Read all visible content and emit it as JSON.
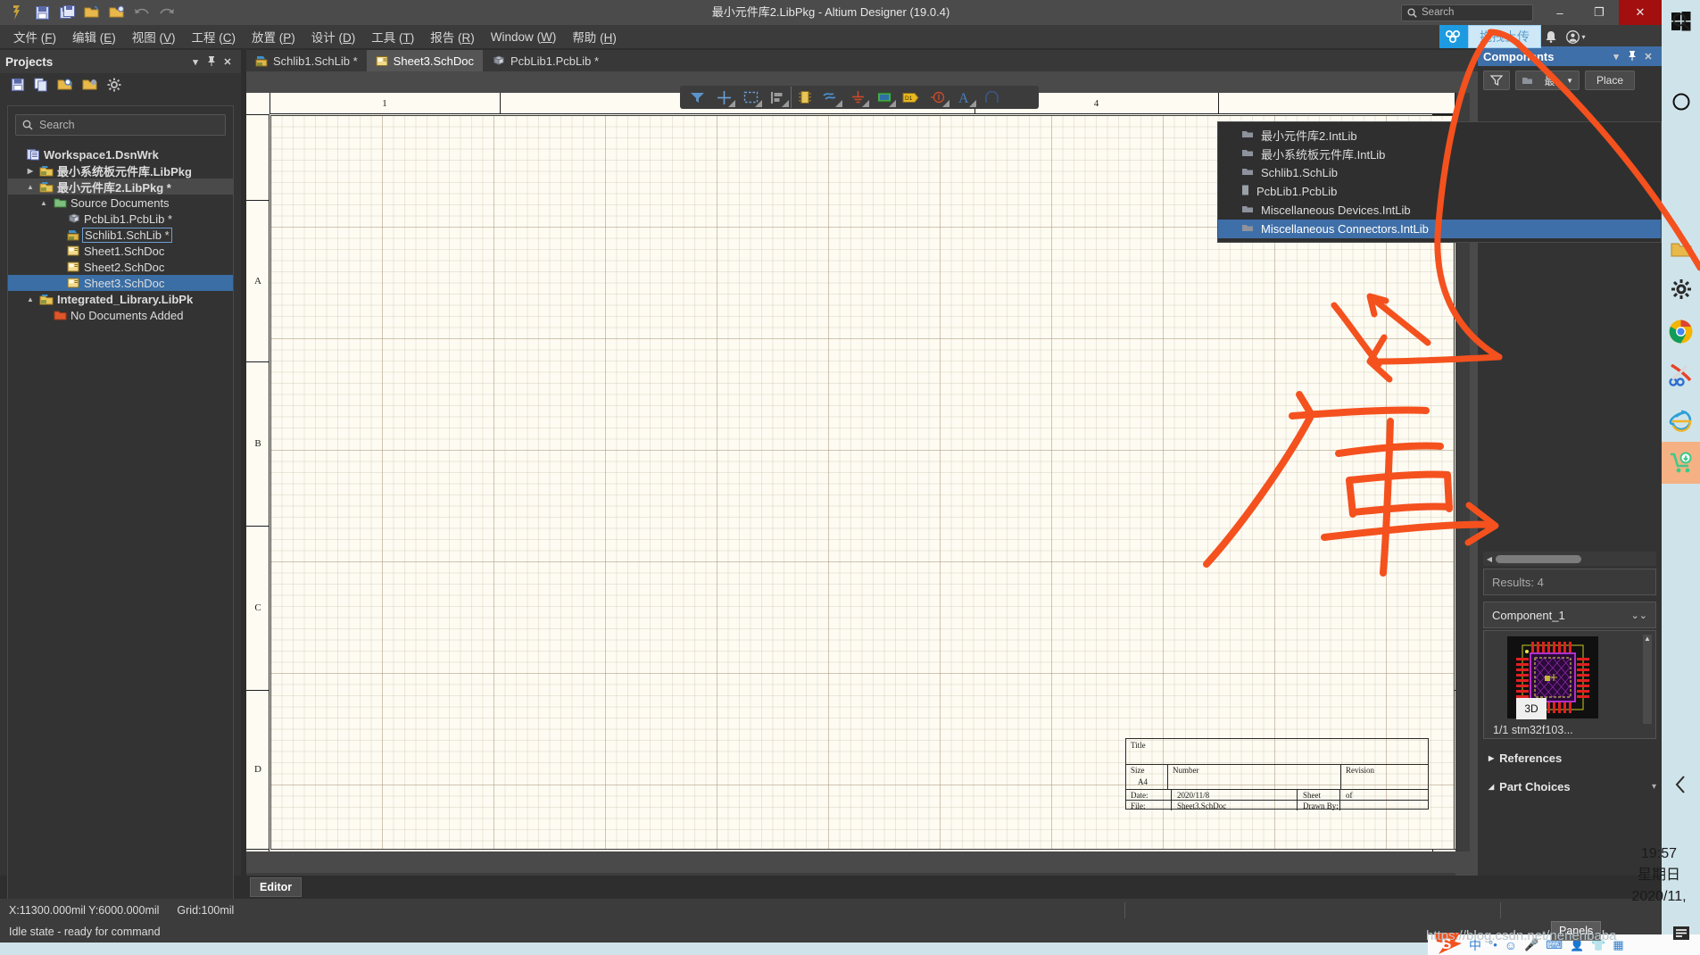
{
  "window": {
    "title": "最小元件库2.LibPkg - Altium Designer (19.0.4)",
    "search_placeholder": "Search",
    "minimize": "–",
    "maximize": "❐",
    "close": "✕"
  },
  "quick_access": [
    {
      "name": "altium-logo-icon",
      "label": "A"
    },
    {
      "name": "save-icon",
      "label": "Save"
    },
    {
      "name": "save-all-icon",
      "label": "Save All"
    },
    {
      "name": "open-icon",
      "label": "Open"
    },
    {
      "name": "open-project-icon",
      "label": "Open Project"
    },
    {
      "name": "undo-icon",
      "label": "Undo"
    },
    {
      "name": "redo-icon",
      "label": "Redo"
    }
  ],
  "menubar": [
    {
      "label": "文件",
      "key": "F"
    },
    {
      "label": "编辑",
      "key": "E"
    },
    {
      "label": "视图",
      "key": "V"
    },
    {
      "label": "工程",
      "key": "C"
    },
    {
      "label": "放置",
      "key": "P"
    },
    {
      "label": "设计",
      "key": "D"
    },
    {
      "label": "工具",
      "key": "T"
    },
    {
      "label": "报告",
      "key": "R"
    },
    {
      "label": "Window",
      "key": "W"
    },
    {
      "label": "帮助",
      "key": "H"
    }
  ],
  "cloud": {
    "badge_label": "拖拽上传",
    "bell": "🔔",
    "account": "▾"
  },
  "projects_panel": {
    "title": "Projects",
    "header_buttons": [
      "▾",
      "📌",
      "✕"
    ],
    "toolbar_icons": [
      "save-icon",
      "copy-icon",
      "open-search-icon",
      "project-settings-icon",
      "gear-icon"
    ],
    "search_placeholder": "Search",
    "tree": [
      {
        "label": "Workspace1.DsnWrk",
        "icon": "workspace-icon",
        "depth": 0,
        "arrow": "",
        "bold": true,
        "state": "none"
      },
      {
        "label": "最小系统板元件库.LibPkg",
        "icon": "libpkg-icon",
        "depth": 1,
        "arrow": "▶",
        "bold": true,
        "state": "none"
      },
      {
        "label": "最小元件库2.LibPkg *",
        "icon": "libpkg-icon",
        "depth": 1,
        "arrow": "▲",
        "bold": true,
        "state": "grey"
      },
      {
        "label": "Source Documents",
        "icon": "folder-icon",
        "depth": 2,
        "arrow": "▲",
        "bold": false,
        "state": "none"
      },
      {
        "label": "PcbLib1.PcbLib *",
        "icon": "pcblib-icon",
        "depth": 3,
        "arrow": "",
        "bold": false,
        "state": "none"
      },
      {
        "label": "Schlib1.SchLib *",
        "icon": "schlib-icon",
        "depth": 3,
        "arrow": "",
        "bold": false,
        "state": "outline"
      },
      {
        "label": "Sheet1.SchDoc",
        "icon": "schdoc-icon",
        "depth": 3,
        "arrow": "",
        "bold": false,
        "state": "none"
      },
      {
        "label": "Sheet2.SchDoc",
        "icon": "schdoc-icon",
        "depth": 3,
        "arrow": "",
        "bold": false,
        "state": "none"
      },
      {
        "label": "Sheet3.SchDoc",
        "icon": "schdoc-icon",
        "depth": 3,
        "arrow": "",
        "bold": false,
        "state": "blue"
      },
      {
        "label": "Integrated_Library.LibPk",
        "icon": "libpkg-icon",
        "depth": 1,
        "arrow": "▲",
        "bold": true,
        "state": "none"
      },
      {
        "label": "No Documents Added",
        "icon": "folder-red-icon",
        "depth": 2,
        "arrow": "",
        "bold": false,
        "state": "none"
      }
    ]
  },
  "doc_tabs": [
    {
      "label": "Schlib1.SchLib *",
      "icon": "schlib-icon",
      "active": false
    },
    {
      "label": "Sheet3.SchDoc",
      "icon": "schdoc-icon",
      "active": true
    },
    {
      "label": "PcbLib1.PcbLib *",
      "icon": "pcblib-icon",
      "active": false
    }
  ],
  "schematic": {
    "float_toolbar": [
      {
        "name": "filter-icon",
        "has_caret": false
      },
      {
        "name": "crosshair-icon",
        "has_caret": true
      },
      {
        "name": "select-area-icon",
        "has_caret": true
      },
      {
        "name": "align-icon",
        "has_caret": true
      },
      {
        "name": "place-part-icon",
        "has_caret": false
      },
      {
        "name": "place-wire-icon",
        "has_caret": true
      },
      {
        "name": "place-gnd-icon",
        "has_caret": true
      },
      {
        "name": "place-sheet-symbol-icon",
        "has_caret": true
      },
      {
        "name": "place-net-label-icon",
        "has_caret": false
      },
      {
        "name": "place-no-erc-icon",
        "has_caret": true
      },
      {
        "name": "place-text-icon",
        "has_caret": true
      },
      {
        "name": "place-arc-icon",
        "has_caret": false
      }
    ],
    "ruler_top": [
      "1",
      "4"
    ],
    "ruler_left": [
      "A",
      "B",
      "C",
      "D"
    ],
    "title_block": {
      "title_label": "Title",
      "size_label": "Size",
      "size_value": "A4",
      "number_label": "Number",
      "revision_label": "Revision",
      "date_label": "Date:",
      "date_value": "2020/11/8",
      "sheet_label": "Sheet",
      "of_label": "of",
      "file_label": "File:",
      "file_value": "Sheet3.SchDoc",
      "drawn_by_label": "Drawn By:"
    }
  },
  "editor_tab": {
    "label": "Editor"
  },
  "components_panel": {
    "title": "Components",
    "header_buttons": [
      "▾",
      "📌",
      "✕"
    ],
    "filter_icon": "funnel-icon",
    "library_selected": "最",
    "place_button": "Place",
    "library_list": [
      {
        "label": "最小元件库2.IntLib",
        "icon": "intlib-icon",
        "selected": false
      },
      {
        "label": "最小系统板元件库.IntLib",
        "icon": "intlib-icon",
        "selected": false
      },
      {
        "label": "Schlib1.SchLib",
        "icon": "intlib-icon",
        "selected": false
      },
      {
        "label": "PcbLib1.PcbLib",
        "icon": "pcblib-small-icon",
        "selected": false
      },
      {
        "label": "Miscellaneous Devices.IntLib",
        "icon": "intlib-icon",
        "selected": false
      },
      {
        "label": "Miscellaneous Connectors.IntLib",
        "icon": "intlib-icon",
        "selected": true
      }
    ],
    "results_text": "Results: 4",
    "component_name": "Component_1",
    "preview_badge": "3D",
    "preview_caption": "1/1  stm32f103...",
    "sections": [
      {
        "label": "References",
        "expanded": false,
        "arrow": "▶"
      },
      {
        "label": "Part Choices",
        "expanded": true,
        "arrow": "◢"
      }
    ]
  },
  "statusbar": {
    "coords": "X:11300.000mil Y:6000.000mil",
    "grid": "Grid:100mil",
    "message": "Idle state - ready for command"
  },
  "taskbar": {
    "panels_button": "Panels",
    "watermark": "https://blog.csdn.net/nenenbaba",
    "clock_time": "19:57",
    "clock_day": "星期日",
    "clock_date": "2020/11,"
  },
  "desktop_sidebar": [
    {
      "name": "windows-start-icon"
    },
    {
      "name": "search-icon"
    },
    {
      "name": "cortana-circle-icon"
    },
    {
      "name": "task-view-icon"
    },
    {
      "name": "explorer-icon"
    },
    {
      "name": "settings-gear-icon"
    },
    {
      "name": "chrome-icon"
    },
    {
      "name": "snipping-tool-icon"
    },
    {
      "name": "internet-explorer-icon"
    },
    {
      "name": "shopping-cart-icon"
    }
  ],
  "sogou_bar": {
    "items": [
      "中",
      "°•",
      "☺",
      "🎤",
      "⌨",
      "👤",
      "👕",
      "▦"
    ]
  },
  "colors": {
    "accent_blue": "#3f6ea8",
    "annotation_red": "#f4511e",
    "canvas": "#fdfbf2",
    "panel_bg": "#333333",
    "titlebar": "#4b4b4b",
    "close_red": "#a30f0f"
  }
}
